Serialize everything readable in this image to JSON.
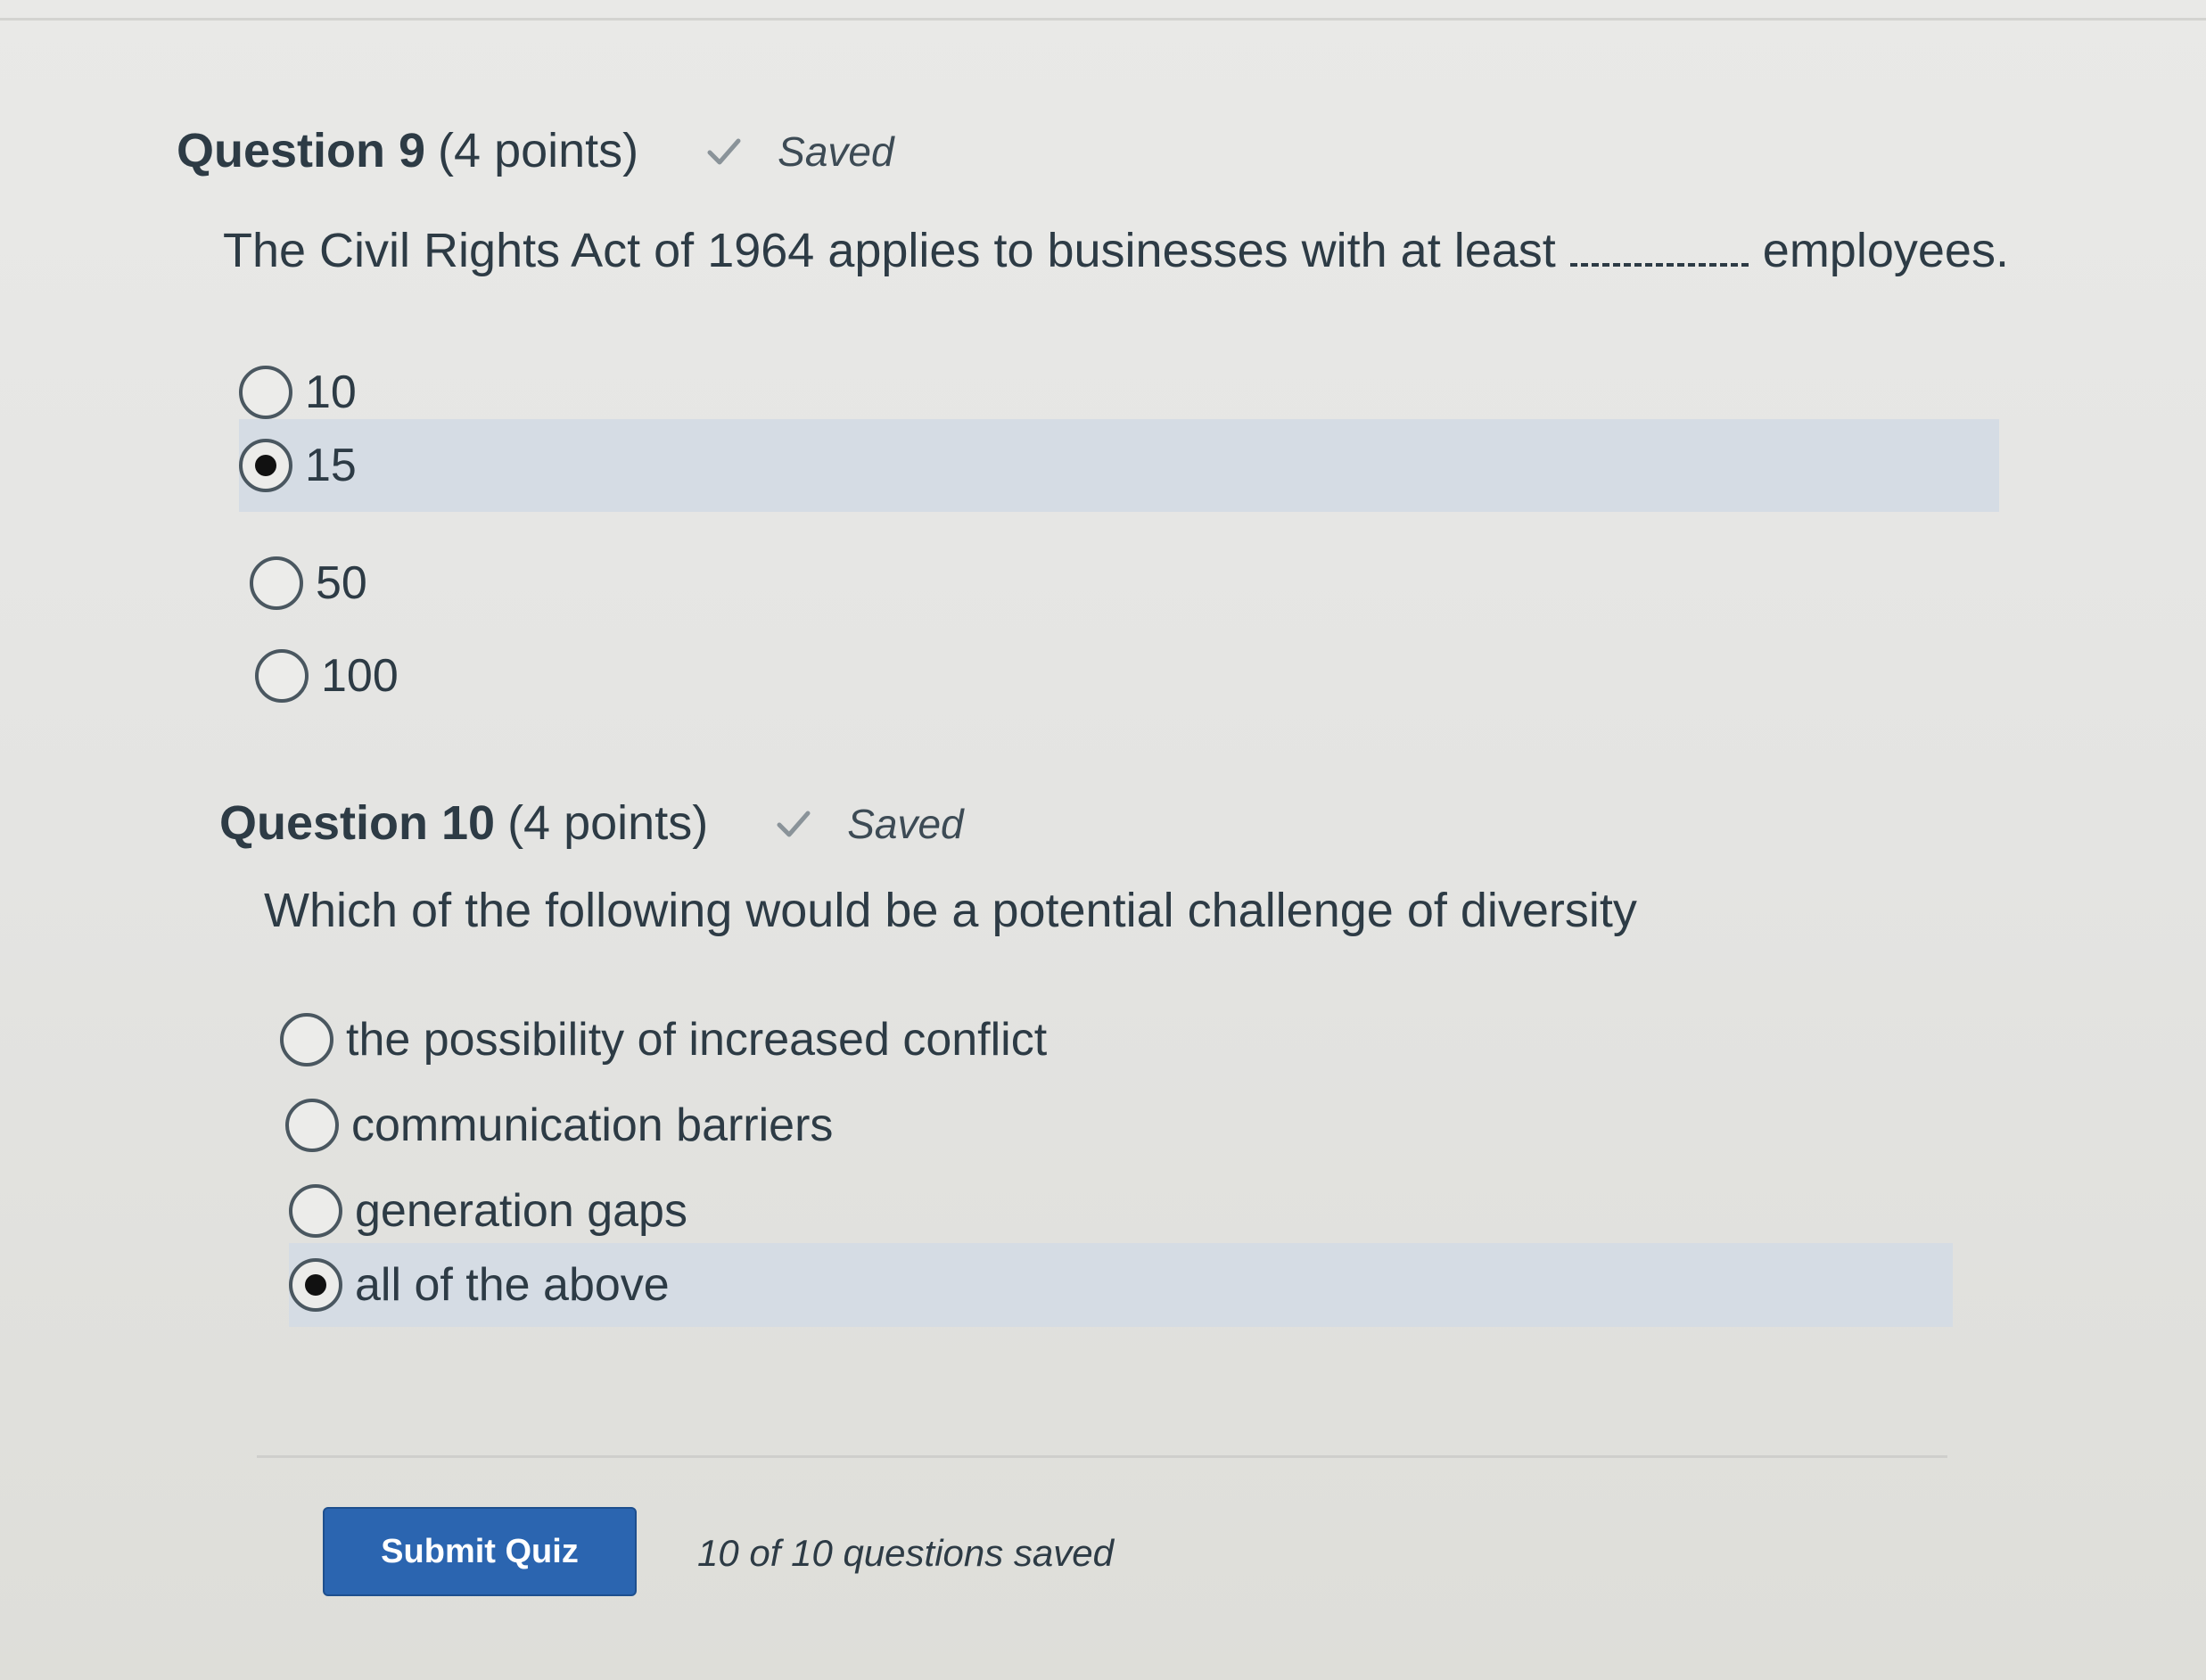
{
  "questions": [
    {
      "title": "Question 9",
      "points": "(4 points)",
      "status": "Saved",
      "text_before": "The Civil Rights Act of 1964 applies to businesses with at least",
      "text_after": "employees.",
      "options": [
        {
          "label": "10",
          "selected": false
        },
        {
          "label": "15",
          "selected": true
        },
        {
          "label": "50",
          "selected": false
        },
        {
          "label": "100",
          "selected": false
        }
      ]
    },
    {
      "title": "Question 10",
      "points": "(4 points)",
      "status": "Saved",
      "text": "Which of the following would be a potential challenge of diversity",
      "options": [
        {
          "label": "the possibility of increased conflict",
          "selected": false
        },
        {
          "label": "communication barriers",
          "selected": false
        },
        {
          "label": "generation gaps",
          "selected": false
        },
        {
          "label": "all of the above",
          "selected": true
        }
      ]
    }
  ],
  "footer": {
    "submit_label": "Submit Quiz",
    "saved_count": "10 of 10 questions saved"
  },
  "colors": {
    "selected_row": "#d5dce4",
    "submit_button": "#2b65b0",
    "text": "#2d3b45"
  },
  "icons": [
    "check-icon",
    "radio-button"
  ]
}
